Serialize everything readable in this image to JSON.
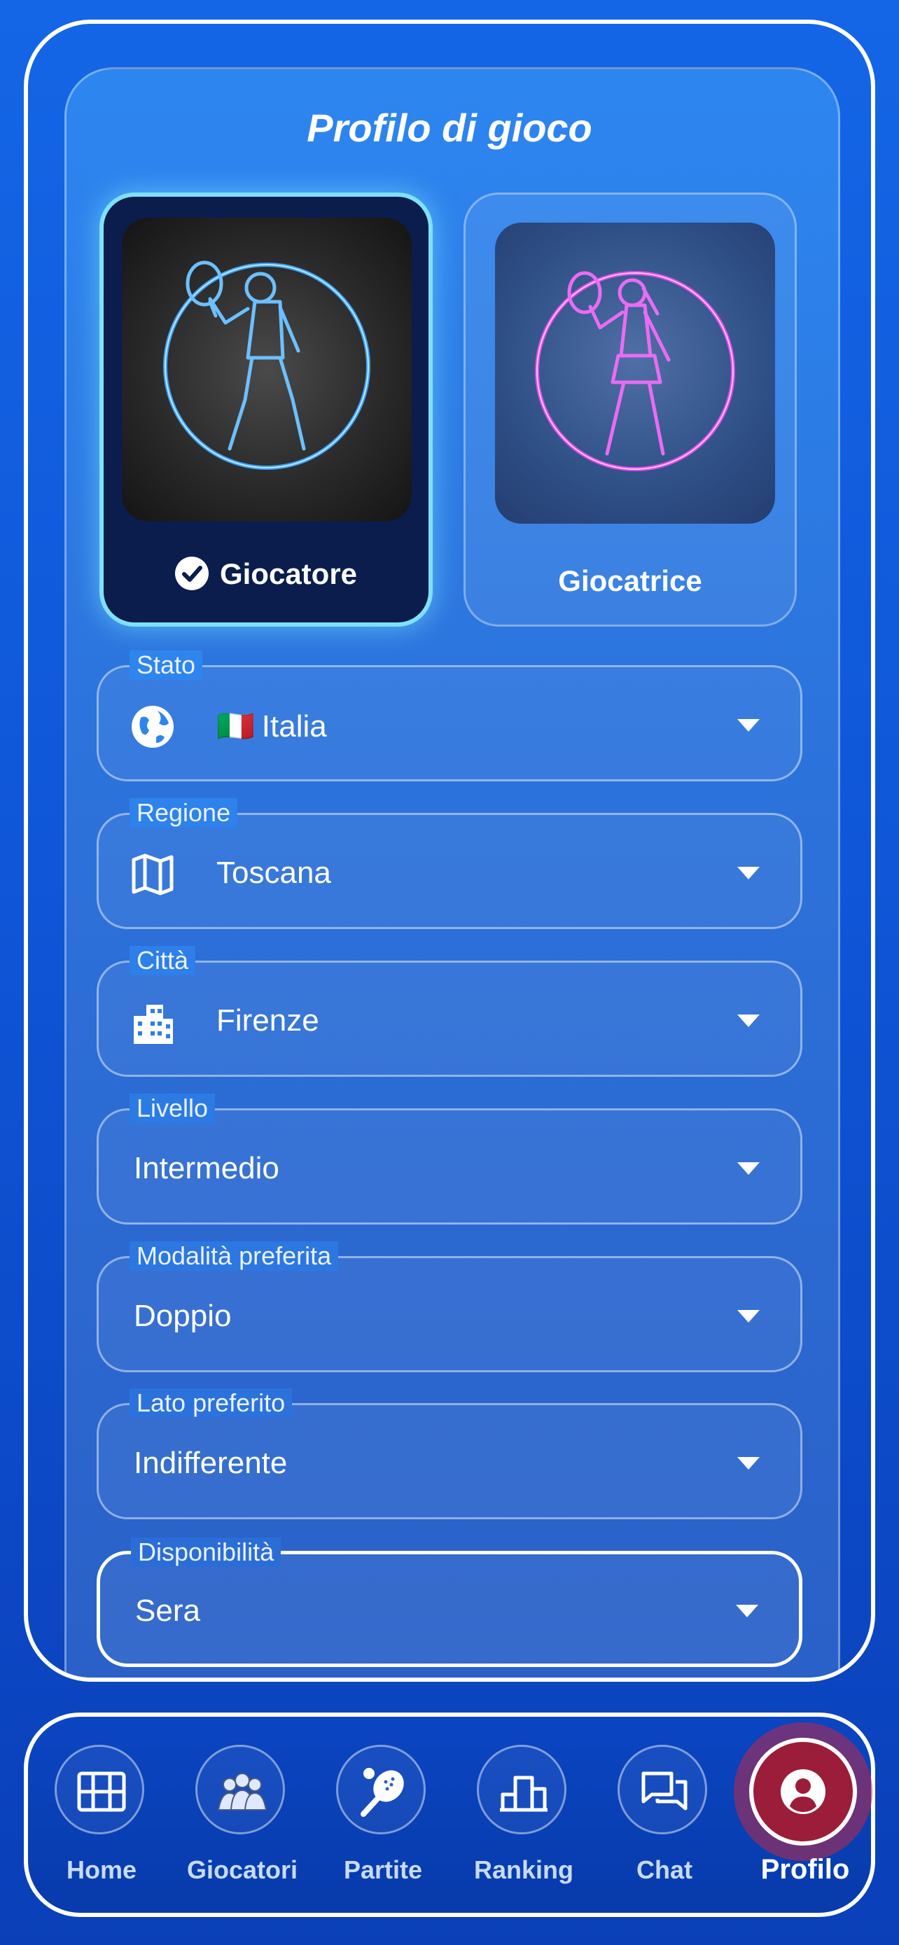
{
  "page": {
    "title": "Profilo di gioco"
  },
  "gender": {
    "options": [
      {
        "label": "Giocatore",
        "selected": true
      },
      {
        "label": "Giocatrice",
        "selected": false
      }
    ]
  },
  "fields": {
    "stato": {
      "label": "Stato",
      "value": "Italia",
      "flag": "🇮🇹",
      "icon": "globe-icon"
    },
    "regione": {
      "label": "Regione",
      "value": "Toscana",
      "icon": "map-icon"
    },
    "citta": {
      "label": "Città",
      "value": "Firenze",
      "icon": "city-icon"
    },
    "livello": {
      "label": "Livello",
      "value": "Intermedio"
    },
    "modalita": {
      "label": "Modalità preferita",
      "value": "Doppio"
    },
    "lato": {
      "label": "Lato preferito",
      "value": "Indifferente"
    },
    "disponibilita": {
      "label": "Disponibilità",
      "value": "Sera"
    }
  },
  "nav": {
    "items": [
      {
        "label": "Home",
        "icon": "court-icon"
      },
      {
        "label": "Giocatori",
        "icon": "players-icon"
      },
      {
        "label": "Partite",
        "icon": "padel-racket-icon"
      },
      {
        "label": "Ranking",
        "icon": "podium-icon"
      },
      {
        "label": "Chat",
        "icon": "chat-icon"
      },
      {
        "label": "Profilo",
        "icon": "profile-icon",
        "active": true
      }
    ]
  },
  "colors": {
    "accent_glow": "#7fe1ff",
    "selected_card_bg": "#0a1d4d",
    "active_nav": "#9c1d3a",
    "male_neon": "#3aa0ff",
    "female_neon": "#e04ae8"
  }
}
